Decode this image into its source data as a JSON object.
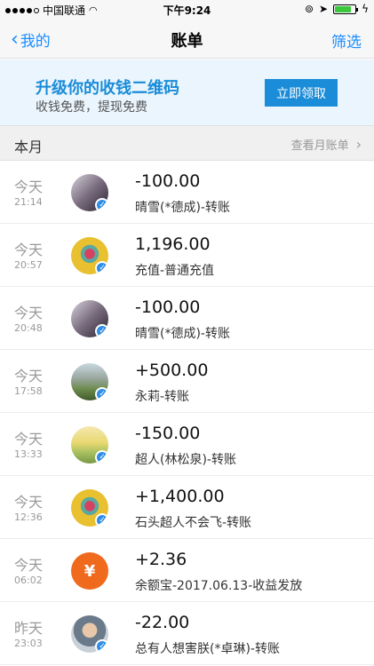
{
  "status_bar": {
    "carrier": "中国联通",
    "time": "下午9:24",
    "battery_level": 0.8
  },
  "nav": {
    "back_label": "我的",
    "title": "账单",
    "filter_label": "筛选"
  },
  "banner": {
    "title": "升级你的收钱二维码",
    "subtitle": "收钱免费，提现免费",
    "button_label": "立即领取"
  },
  "month": {
    "label": "本月",
    "link_label": "查看月账单"
  },
  "transactions": [
    {
      "day": "今天",
      "time": "21:14",
      "amount": "-100.00",
      "desc": "晴雪(*德成)-转账",
      "avatar": "dark-photo"
    },
    {
      "day": "今天",
      "time": "20:57",
      "amount": "1,196.00",
      "desc": "充值-普通充值",
      "avatar": "yellow-character"
    },
    {
      "day": "今天",
      "time": "20:48",
      "amount": "-100.00",
      "desc": "晴雪(*德成)-转账",
      "avatar": "dark-photo"
    },
    {
      "day": "今天",
      "time": "17:58",
      "amount": "+500.00",
      "desc": "永莉-转账",
      "avatar": "garden-photo"
    },
    {
      "day": "今天",
      "time": "13:33",
      "amount": "-150.00",
      "desc": "超人(林松泉)-转账",
      "avatar": "sunset-photo"
    },
    {
      "day": "今天",
      "time": "12:36",
      "amount": "+1,400.00",
      "desc": "石头超人不会飞-转账",
      "avatar": "yellow-character"
    },
    {
      "day": "今天",
      "time": "06:02",
      "amount": "+2.36",
      "desc": "余额宝-2017.06.13-收益发放",
      "avatar": "yuebao-icon"
    },
    {
      "day": "昨天",
      "time": "23:03",
      "amount": "-22.00",
      "desc": "总有人想害朕(*卓琳)-转账",
      "avatar": "man-photo"
    }
  ]
}
